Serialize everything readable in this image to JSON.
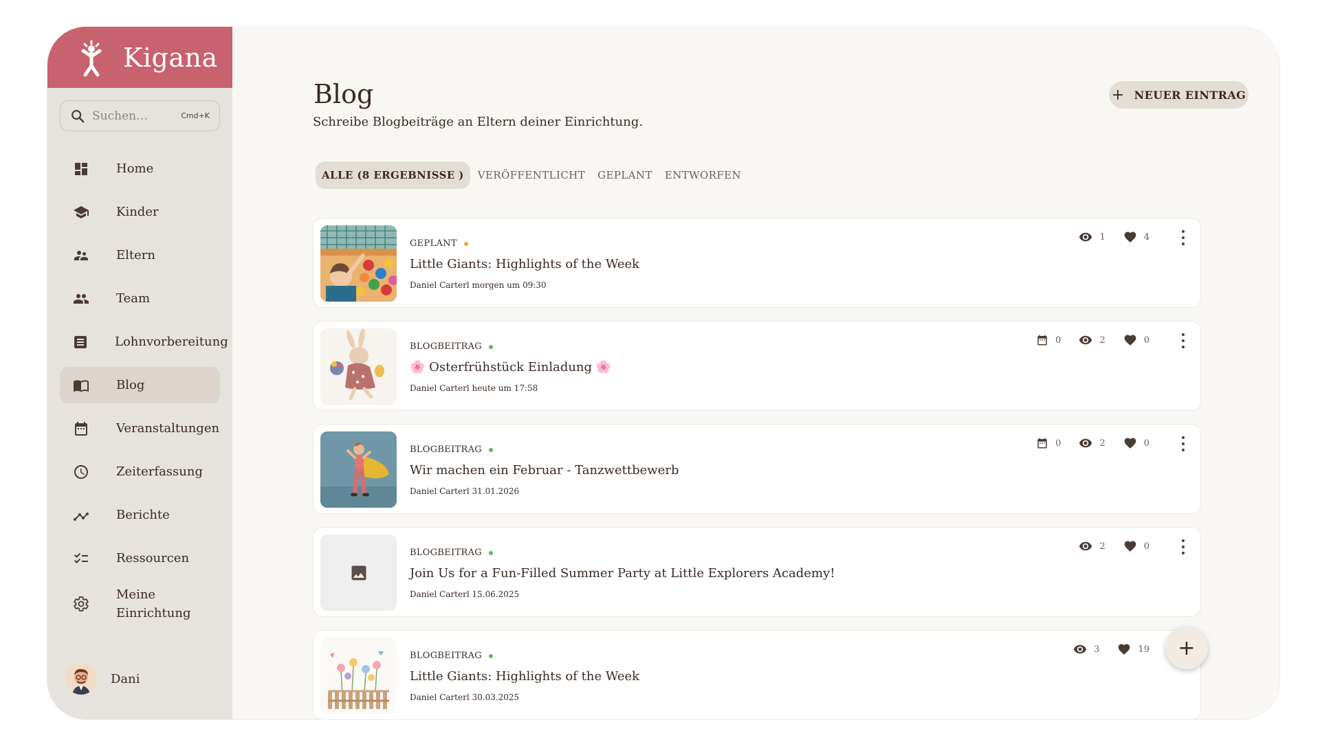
{
  "brand": {
    "name": "Kigana",
    "color": "#c7626e"
  },
  "search": {
    "placeholder": "Suchen…",
    "shortcut": "Cmd+K"
  },
  "sidebar": {
    "items": [
      {
        "label": "Home",
        "icon": "dashboard-icon"
      },
      {
        "label": "Kinder",
        "icon": "school-icon"
      },
      {
        "label": "Eltern",
        "icon": "people-icon"
      },
      {
        "label": "Team",
        "icon": "group-icon"
      },
      {
        "label": "Lohnvorbereitung",
        "icon": "document-icon"
      },
      {
        "label": "Blog",
        "icon": "book-icon",
        "active": true
      },
      {
        "label": "Veranstaltungen",
        "icon": "calendar-icon"
      },
      {
        "label": "Zeiterfassung",
        "icon": "clock-icon"
      },
      {
        "label": "Berichte",
        "icon": "chart-icon"
      },
      {
        "label": "Ressourcen",
        "icon": "checklist-icon"
      },
      {
        "label_line1": "Meine",
        "label_line2": "Einrichtung",
        "icon": "gear-icon"
      }
    ]
  },
  "user": {
    "name": "Dani"
  },
  "header": {
    "title": "Blog",
    "subtitle": "Schreibe Blogbeiträge an Eltern deiner Einrichtung.",
    "new_button": "NEUER EINTRAG"
  },
  "tabs": [
    {
      "label": "ALLE (8 ERGEBNISSE )",
      "active": true
    },
    {
      "label": "VERÖFFENTLICHT"
    },
    {
      "label": "GEPLANT"
    },
    {
      "label": "ENTWORFEN"
    }
  ],
  "posts": [
    {
      "status": "GEPLANT",
      "status_color": "#f0a92c",
      "title": "Little Giants: Highlights of the Week",
      "meta": "Daniel Carterl morgen um 09:30",
      "views": "1",
      "likes": "4",
      "thumb": "ball-pit"
    },
    {
      "status": "BLOGBEITRAG",
      "status_color": "#5cb85c",
      "title": "🌸 Osterfrühstück Einladung 🌸",
      "meta": "Daniel Carterl heute um 17:58",
      "events": "0",
      "views": "2",
      "likes": "0",
      "thumb": "easter-bunny"
    },
    {
      "status": "BLOGBEITRAG",
      "status_color": "#5cb85c",
      "title": "Wir machen ein Februar - Tanzwettbewerb",
      "meta": "Daniel Carterl 31.01.2026",
      "events": "0",
      "views": "2",
      "likes": "0",
      "thumb": "dancer"
    },
    {
      "status": "BLOGBEITRAG",
      "status_color": "#5cb85c",
      "title": "Join Us for a Fun-Filled Summer Party at Little Explorers Academy!",
      "meta": "Daniel Carterl 15.06.2025",
      "views": "2",
      "likes": "0",
      "thumb": "image-placeholder"
    },
    {
      "status": "BLOGBEITRAG",
      "status_color": "#5cb85c",
      "title": "Little Giants: Highlights of the Week",
      "meta": "Daniel Carterl 30.03.2025",
      "views": "3",
      "likes": "19",
      "thumb": "flowers"
    }
  ],
  "fab": {
    "label": "+"
  }
}
